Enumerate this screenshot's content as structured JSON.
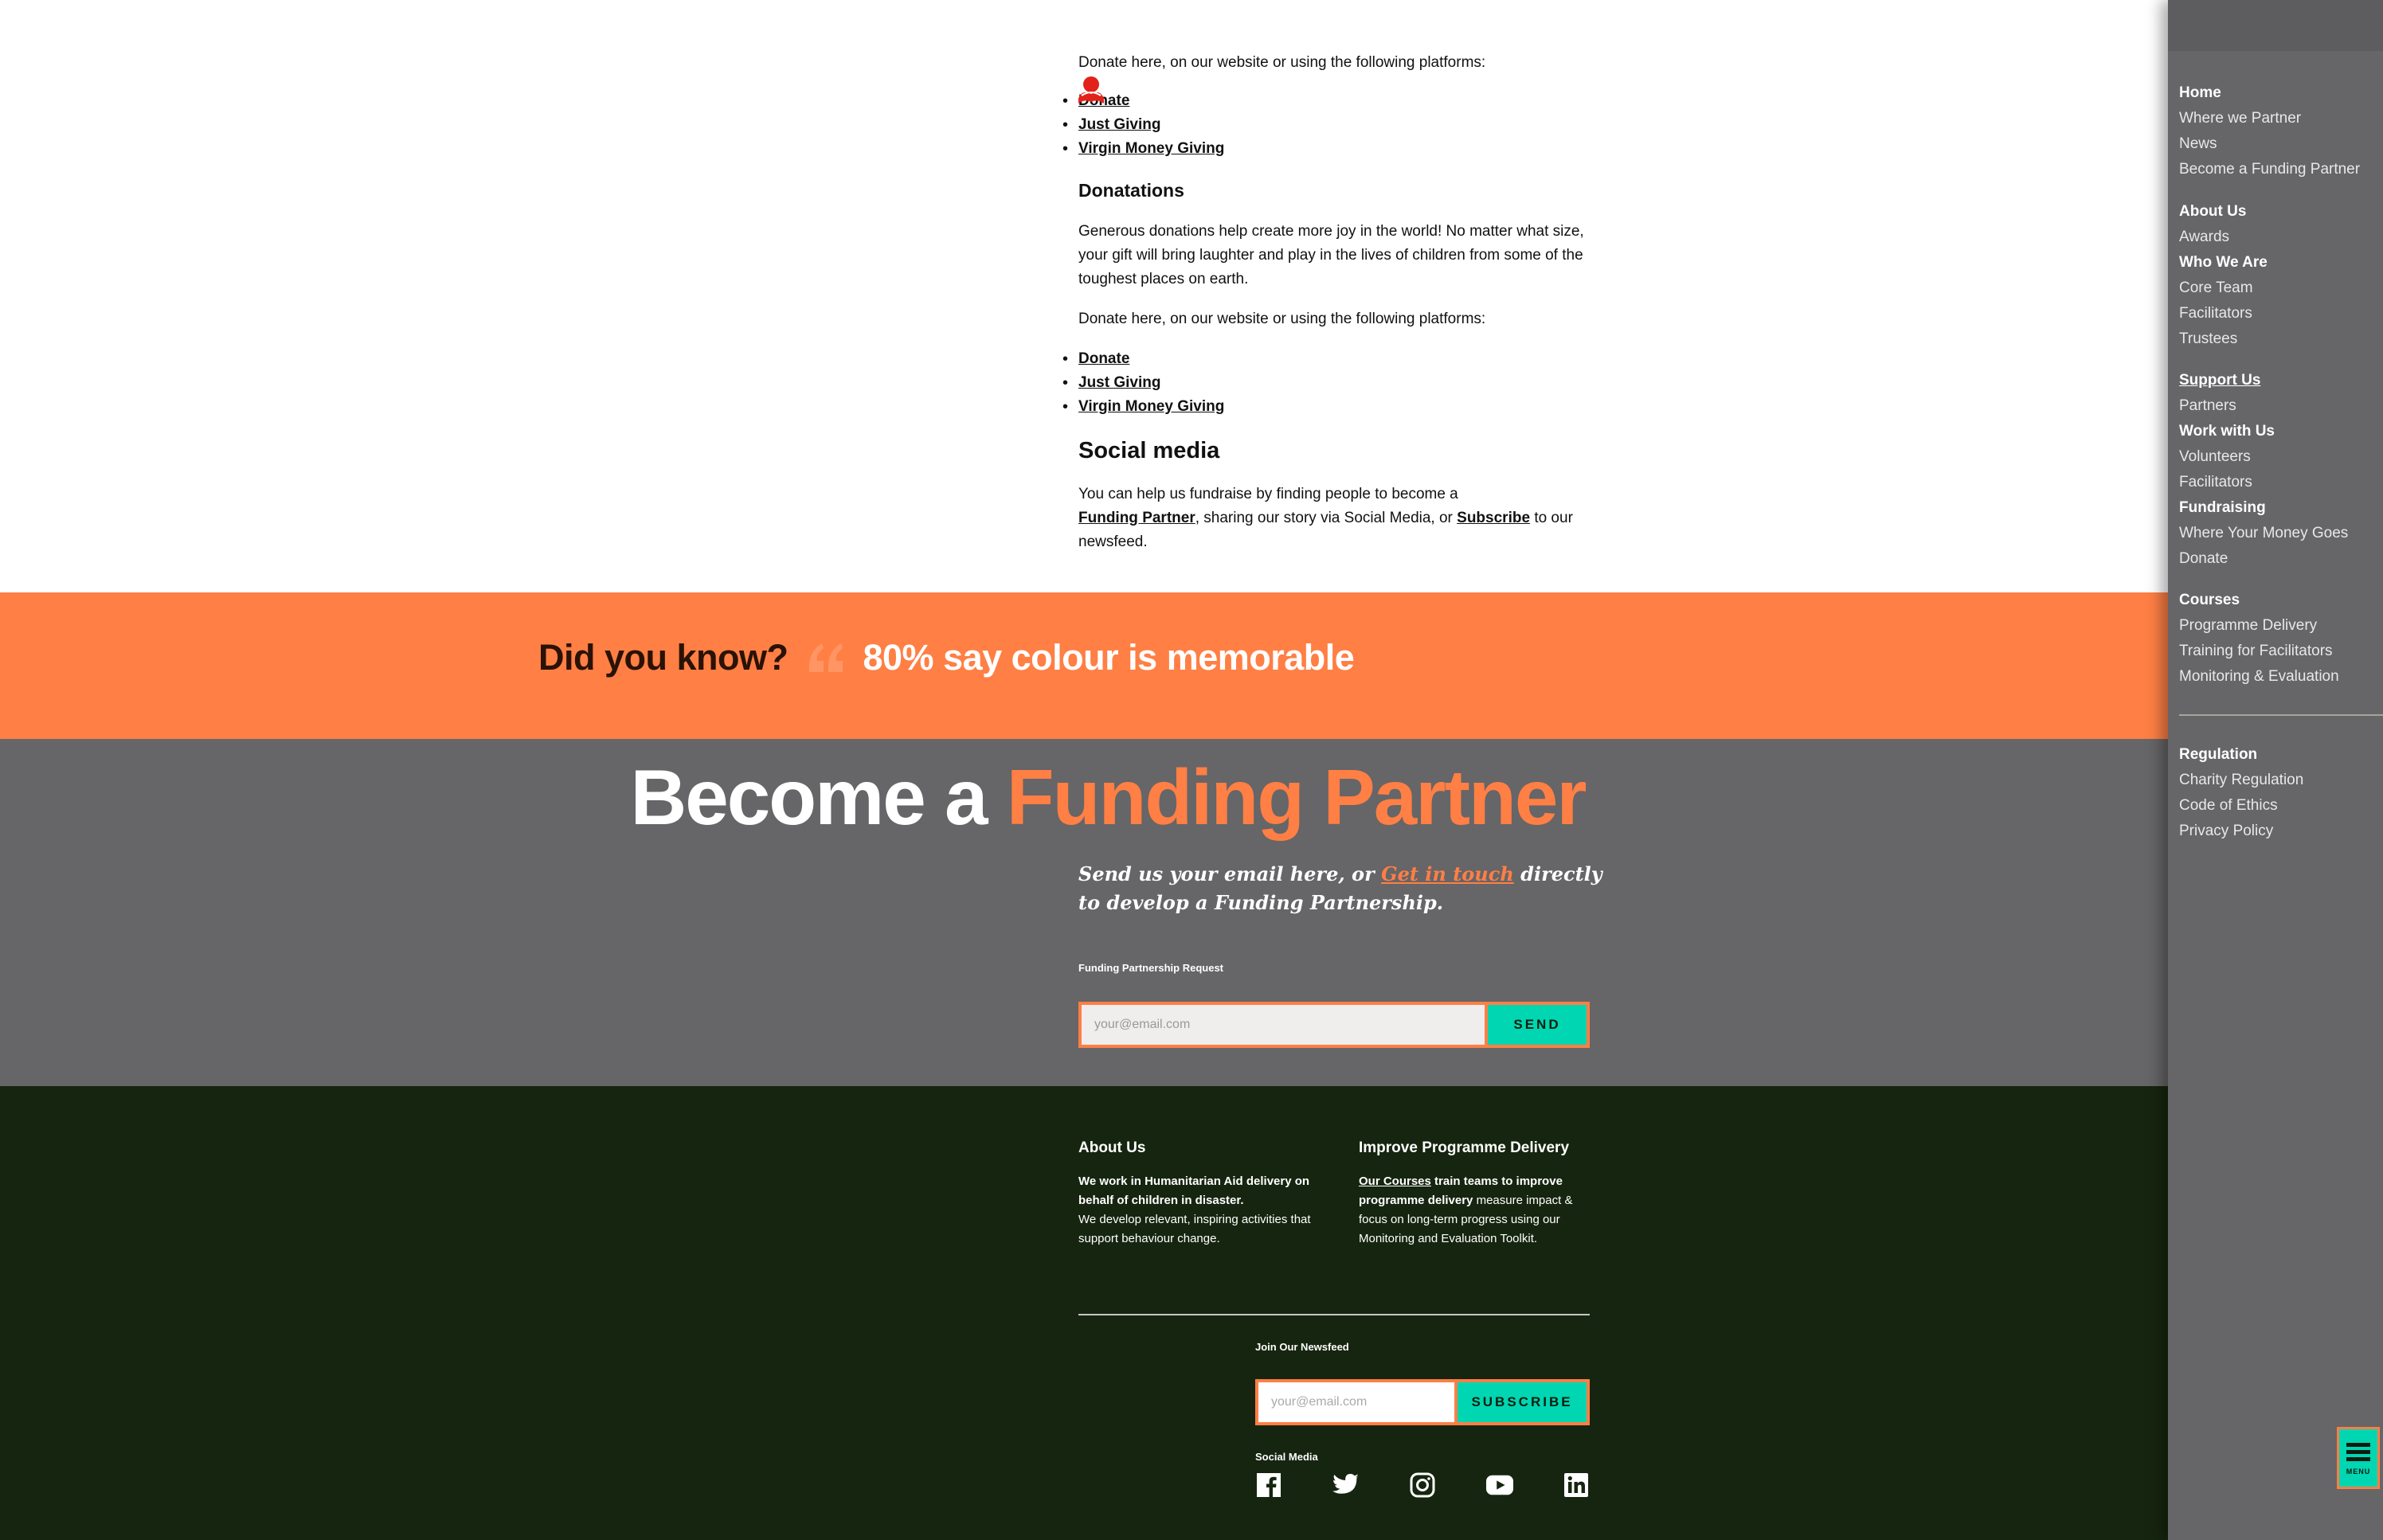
{
  "content": {
    "intro_text": "Donate here, on our website or using the following platforms:",
    "platforms_1": [
      "Donate",
      "Just Giving",
      "Virgin Money Giving"
    ],
    "donations_heading": "Donatations",
    "donations_text": "Generous donations help create more joy in the world! No matter what size, your gift will bring laughter and play in the lives of children from some of the toughest places on earth.",
    "donate_text_2": "Donate here, on our website or using the following platforms:",
    "platforms_2": [
      "Donate",
      "Just Giving",
      "Virgin Money Giving"
    ],
    "social_heading": "Social media",
    "social_text_1": "You can help us fundraise by finding people to become a",
    "social_link_partner": "Funding Partner",
    "social_text_2": ", sharing our story via Social Media, or",
    "social_link_subscribe": "Subscribe",
    "social_text_3": "to our",
    "social_text_4": "newsfeed."
  },
  "banner": {
    "question": "Did you know?",
    "fact": "80% say colour is memorable",
    "color": "#ff7f45"
  },
  "partner": {
    "title_1": "Become a",
    "title_2": "Funding Partner",
    "lead_1": "Send us your email here, or",
    "lead_link": "Get in touch",
    "lead_2": "directly to develop a Funding Partnership.",
    "form_label": "Funding Partnership Request",
    "email_placeholder": "your@email.com",
    "send_label": "SEND"
  },
  "footer": {
    "about_heading": "About Us",
    "about_bold": "We work in Humanitarian Aid delivery on behalf of children in disaster.",
    "about_text": "We develop relevant, inspiring activities that support behaviour change.",
    "improve_heading": "Improve Programme Delivery",
    "improve_link": "Our Courses",
    "improve_bold": "train teams to improve programme delivery",
    "improve_text": "measure impact & focus on long-term progress using our Monitoring and Evaluation Toolkit.",
    "newsfeed_label": "Join Our Newsfeed",
    "newsfeed_placeholder": "your@email.com",
    "subscribe_label": "SUBSCRIBE",
    "social_label": "Social Media",
    "social_icons": [
      "facebook-icon",
      "twitter-icon",
      "instagram-icon",
      "youtube-icon",
      "linkedin-icon"
    ]
  },
  "nav": {
    "items": [
      "Home",
      "Where we Partner",
      "News",
      "Become a Funding Partner",
      "About Us",
      "Awards",
      "Who We Are",
      "Core Team",
      "Facilitators",
      "Trustees",
      "Support Us",
      "Partners",
      "Work with Us",
      "Volunteers",
      "Facilitators",
      "Fundraising",
      "Where Your Money Goes",
      "Donate",
      "Courses",
      "Programme Delivery",
      "Training for Facilitators",
      "Monitoring & Evaluation",
      "Regulation",
      "Charity Regulation",
      "Code of Ethics",
      "Privacy Policy"
    ],
    "menu_label": "MENU"
  },
  "colors": {
    "accent": "#ff7f45",
    "teal": "#00d6b1",
    "grey_panel": "#666567",
    "footer_bg": "#16250f"
  }
}
